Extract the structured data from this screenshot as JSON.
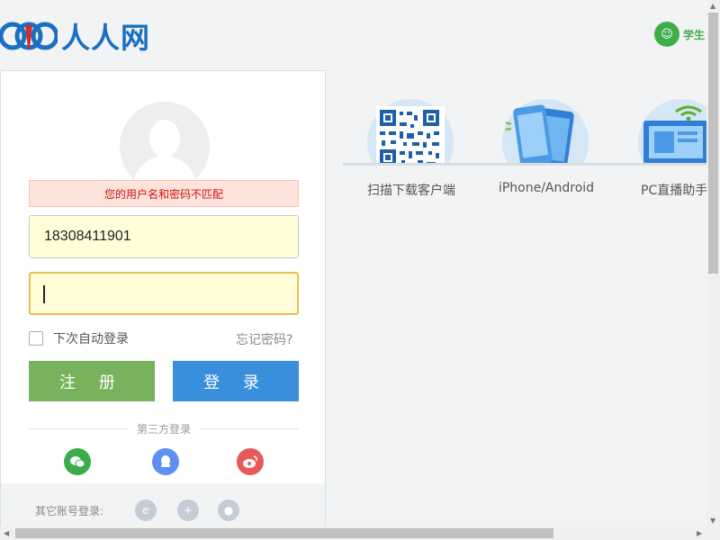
{
  "header": {
    "logo_text": "人人网",
    "student_label": "学生"
  },
  "login": {
    "error_message": "您的用户名和密码不匹配",
    "username_value": "18308411901",
    "password_value": "",
    "remember_label": "下次自动登录",
    "forgot_label": "忘记密码?",
    "register_button": "注 册",
    "login_button": "登 录",
    "third_party_label": "第三方登录",
    "other_accounts_label": "其它账号登录:"
  },
  "apps": [
    {
      "label": "扫描下载客户端",
      "icon": "qr-code-icon"
    },
    {
      "label": "iPhone/Android",
      "icon": "phone-icon"
    },
    {
      "label": "PC直播助手",
      "icon": "pc-icon"
    }
  ],
  "colors": {
    "brand_blue": "#1a6fc2",
    "register_green": "#78b25d",
    "login_blue": "#3a8fdc",
    "error_red": "#d01010",
    "wechat_green": "#3cab4a",
    "qq_blue": "#5f8ff2",
    "weibo_red": "#e85a5a"
  }
}
